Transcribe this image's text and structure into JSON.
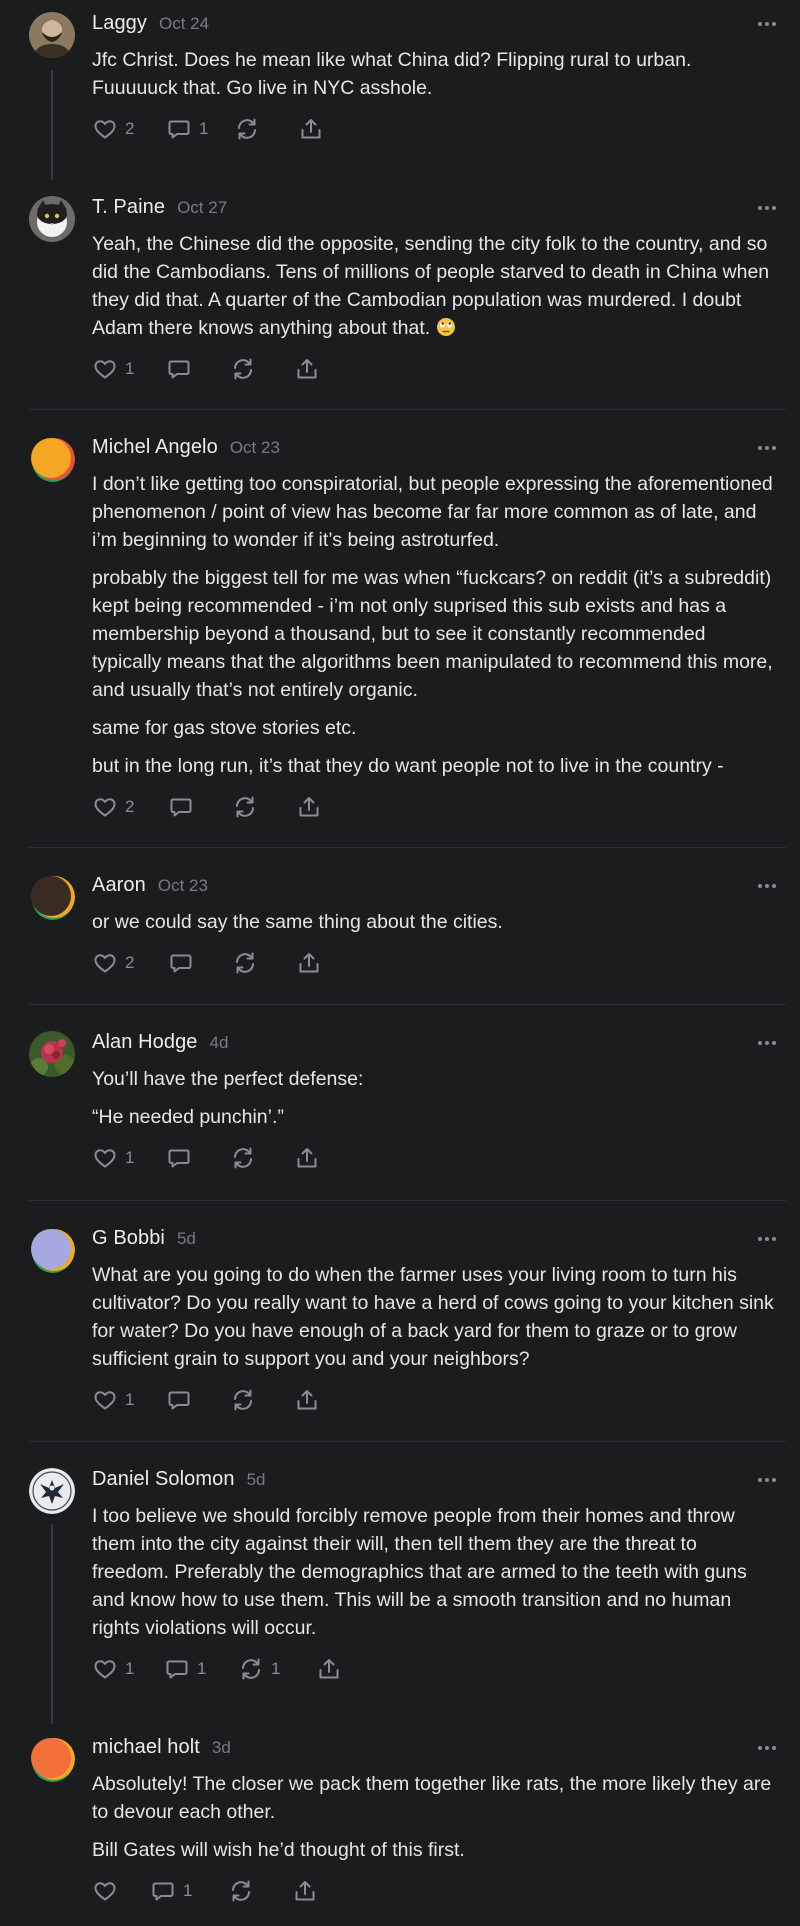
{
  "colors": {
    "background": "#1b1c1e",
    "text": "#e6e6e7",
    "muted": "#7a7b7f",
    "icon": "#8b8c90",
    "divider": "#2d2e31"
  },
  "comments": [
    {
      "author": "Laggy",
      "time": "Oct 24",
      "paragraphs": [
        "Jfc Christ. Does he mean like what China did? Flipping rural to urban. Fuuuuuck that. Go live in NYC asshole."
      ],
      "likes": "2",
      "replies": "1",
      "restacks": ""
    },
    {
      "author": "T. Paine",
      "time": "Oct 27",
      "paragraphs": [
        "Yeah, the Chinese did the opposite, sending the city folk to the country, and so did the Cambodians. Tens of millions of people starved to death in China when they did that. A quarter of the Cambodian population was murdered. I doubt Adam there knows anything about that."
      ],
      "emoji": "face-with-rolling-eyes-icon",
      "likes": "1",
      "replies": "",
      "restacks": ""
    },
    {
      "author": "Michel Angelo",
      "time": "Oct 23",
      "paragraphs": [
        "I don’t like getting too conspiratorial, but people expressing the aforementioned phenomenon / point of view has become far far more common as of late, and i’m beginning to wonder if it’s being astroturfed.",
        "probably the biggest tell for me was when “fuckcars? on reddit (it’s a subreddit) kept being recommended - i’m not only suprised this sub exists and has a membership beyond a thousand, but to see it constantly recommended typically means that the algorithms been manipulated to recommend this more, and usually that’s not entirely organic.",
        "same for gas stove stories etc.",
        "but in the long run, it’s that they do want people not to live in the country -"
      ],
      "likes": "2",
      "replies": "",
      "restacks": ""
    },
    {
      "author": "Aaron",
      "time": "Oct 23",
      "paragraphs": [
        "or we could say the same thing about the cities."
      ],
      "likes": "2",
      "replies": "",
      "restacks": ""
    },
    {
      "author": "Alan Hodge",
      "time": "4d",
      "paragraphs": [
        "You’ll have the perfect defense:",
        "“He needed punchin’.”"
      ],
      "likes": "1",
      "replies": "",
      "restacks": ""
    },
    {
      "author": "G Bobbi",
      "time": "5d",
      "paragraphs": [
        "What are you going to do when the farmer uses your living room to turn his cultivator? Do you really want to have a herd of cows going to your kitchen sink for water? Do you have enough of a back yard for them to graze or to grow sufficient grain to support you and your neighbors?"
      ],
      "likes": "1",
      "replies": "",
      "restacks": ""
    },
    {
      "author": "Daniel Solomon",
      "time": "5d",
      "paragraphs": [
        "I too believe we should forcibly remove people from their homes and throw them into the city against their will, then tell them they are the threat to freedom. Preferably the demographics that are armed to the teeth with guns and know how to use them. This will be a smooth transition and no human rights violations will occur."
      ],
      "likes": "1",
      "replies": "1",
      "restacks": "1"
    },
    {
      "author": "michael holt",
      "time": "3d",
      "paragraphs": [
        "Absolutely! The closer we pack them together like rats, the more likely they are to devour each other.",
        "Bill Gates will wish he’d thought of this first."
      ],
      "likes": "",
      "replies": "1",
      "restacks": ""
    }
  ]
}
